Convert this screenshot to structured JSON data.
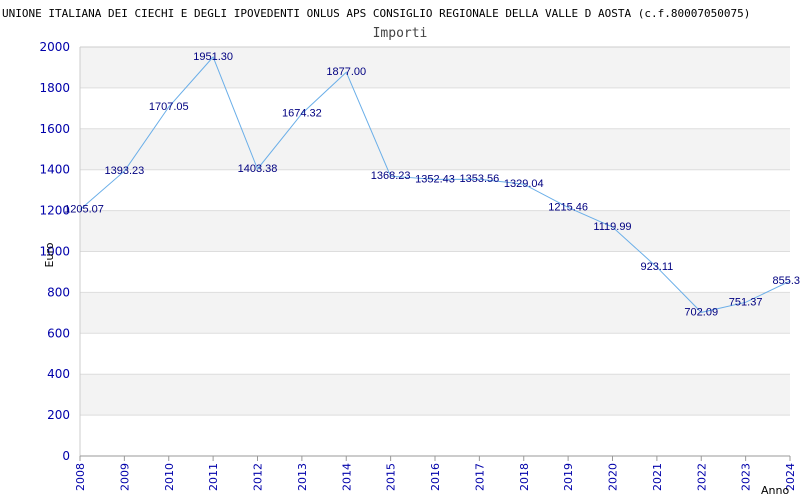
{
  "chart_data": {
    "type": "line",
    "title": "UNIONE ITALIANA DEI CIECHI E DEGLI IPOVEDENTI ONLUS APS CONSIGLIO REGIONALE DELLA VALLE D AOSTA (c.f.80007050075)",
    "subtitle": "Importi",
    "xlabel": "Anno",
    "ylabel": "Euro",
    "ylim": [
      0,
      2000
    ],
    "yticks": [
      "0",
      "200",
      "400",
      "600",
      "800",
      "1000",
      "1200",
      "1400",
      "1600",
      "1800",
      "2000"
    ],
    "x": [
      "2008",
      "2009",
      "2010",
      "2011",
      "2012",
      "2013",
      "2014",
      "2015",
      "2016",
      "2017",
      "2018",
      "2019",
      "2020",
      "2021",
      "2022",
      "2023",
      "2024"
    ],
    "values": [
      1205.07,
      1393.23,
      1707.05,
      1951.3,
      1403.38,
      1674.32,
      1877.0,
      1368.23,
      1352.43,
      1353.56,
      1329.04,
      1215.46,
      1119.99,
      923.11,
      702.09,
      751.37,
      855.3
    ],
    "labels": [
      "1205.07",
      "1393.23",
      "1707.05",
      "1951.30",
      "1403.38",
      "1674.32",
      "1877.00",
      "1368.23",
      "1352.43",
      "1353.56",
      "1329.04",
      "1215.46",
      "1119.99",
      "923.11",
      "702.09",
      "751.37",
      "855.3"
    ],
    "grid": true,
    "colors": {
      "line": "#6aaee8",
      "tick": "#0000aa",
      "label": "#000080",
      "band": "#f3f3f3"
    }
  }
}
